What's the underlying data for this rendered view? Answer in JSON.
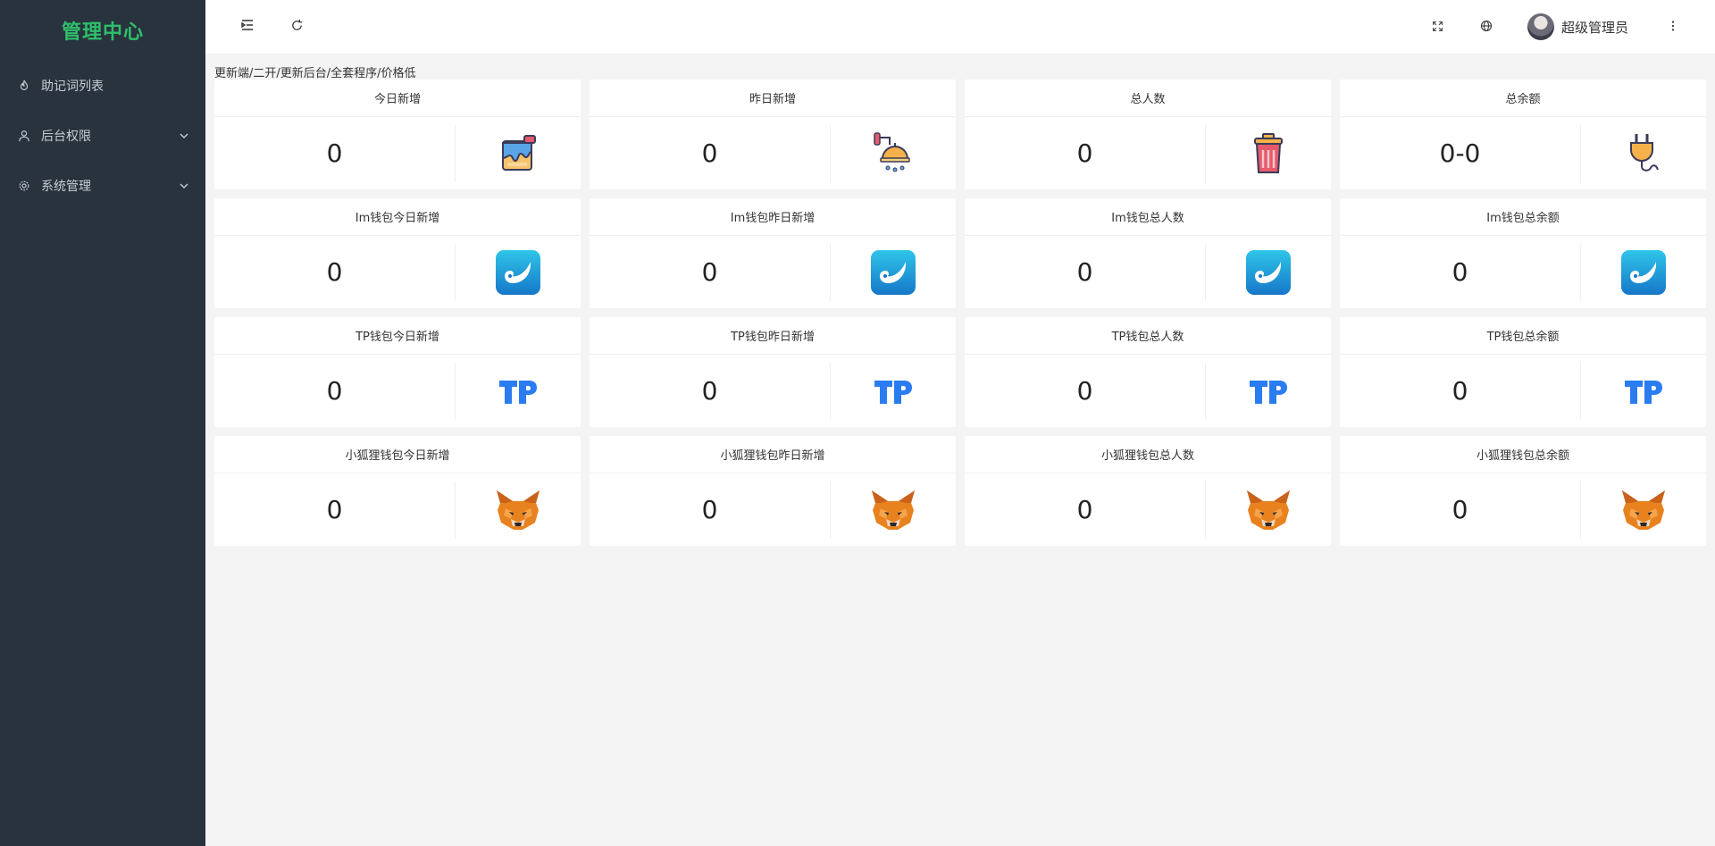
{
  "sidebar": {
    "brand": "管理中心",
    "items": [
      {
        "label": "助记词列表",
        "icon": "fire-icon",
        "expandable": false
      },
      {
        "label": "后台权限",
        "icon": "user-icon",
        "expandable": true
      },
      {
        "label": "系统管理",
        "icon": "gear-icon",
        "expandable": true
      }
    ]
  },
  "header": {
    "user_name": "超级管理员"
  },
  "notice": "更新端/二开/更新后台/全套程序/价格低",
  "cards": [
    {
      "title": "今日新增",
      "value": "0",
      "icon": "paint-bucket-icon"
    },
    {
      "title": "昨日新增",
      "value": "0",
      "icon": "shower-icon"
    },
    {
      "title": "总人数",
      "value": "0",
      "icon": "trash-can-icon"
    },
    {
      "title": "总余额",
      "value": "0-0",
      "icon": "plug-icon"
    },
    {
      "title": "Im钱包今日新增",
      "value": "0",
      "icon": "imtoken-icon"
    },
    {
      "title": "Im钱包昨日新增",
      "value": "0",
      "icon": "imtoken-icon"
    },
    {
      "title": "Im钱包总人数",
      "value": "0",
      "icon": "imtoken-icon"
    },
    {
      "title": "Im钱包总余额",
      "value": "0",
      "icon": "imtoken-icon"
    },
    {
      "title": "TP钱包今日新增",
      "value": "0",
      "icon": "tp-icon"
    },
    {
      "title": "TP钱包昨日新增",
      "value": "0",
      "icon": "tp-icon"
    },
    {
      "title": "TP钱包总人数",
      "value": "0",
      "icon": "tp-icon"
    },
    {
      "title": "TP钱包总余额",
      "value": "0",
      "icon": "tp-icon"
    },
    {
      "title": "小狐狸钱包今日新增",
      "value": "0",
      "icon": "metamask-fox-icon"
    },
    {
      "title": "小狐狸钱包昨日新增",
      "value": "0",
      "icon": "metamask-fox-icon"
    },
    {
      "title": "小狐狸钱包总人数",
      "value": "0",
      "icon": "metamask-fox-icon"
    },
    {
      "title": "小狐狸钱包总余额",
      "value": "0",
      "icon": "metamask-fox-icon"
    }
  ],
  "colors": {
    "sidebar_bg": "#28333e",
    "brand": "#2fbf6a",
    "tp_blue": "#2b7cf0",
    "fox_orange": "#e8821e"
  }
}
